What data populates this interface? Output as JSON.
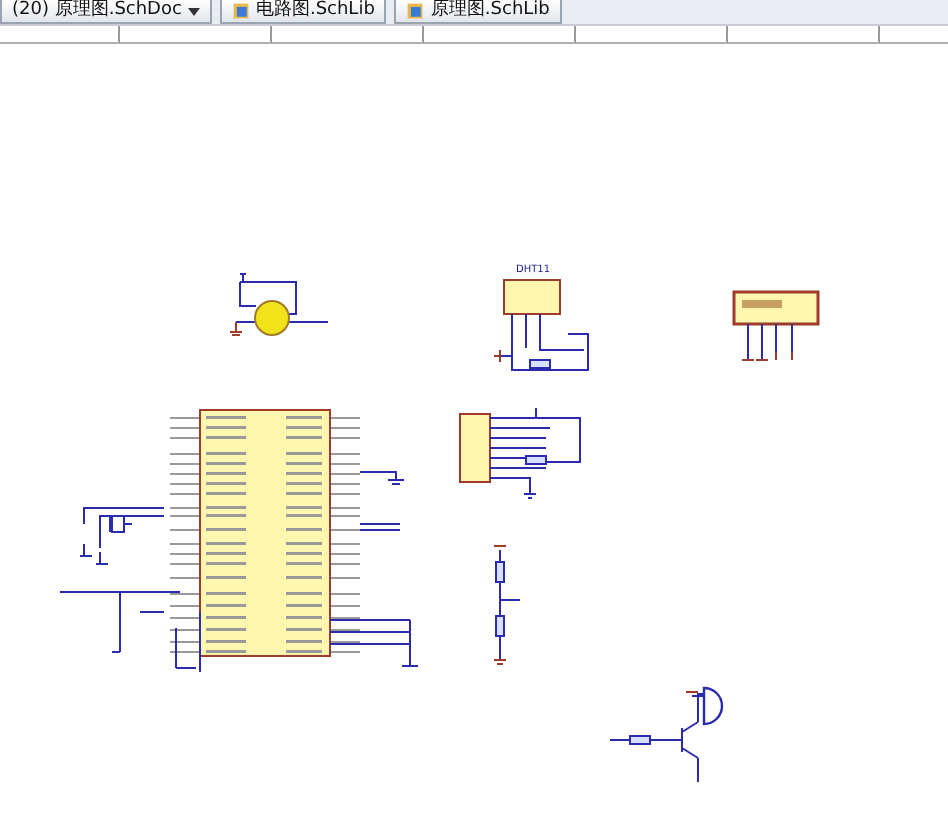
{
  "tabs": [
    {
      "label": "(20) 原理图.SchDoc",
      "kind": "dropdown"
    },
    {
      "label": "电路图.SchLib",
      "kind": "library"
    },
    {
      "label": "原理图.SchLib",
      "kind": "library"
    }
  ],
  "sensor": {
    "label": "DHT11"
  }
}
